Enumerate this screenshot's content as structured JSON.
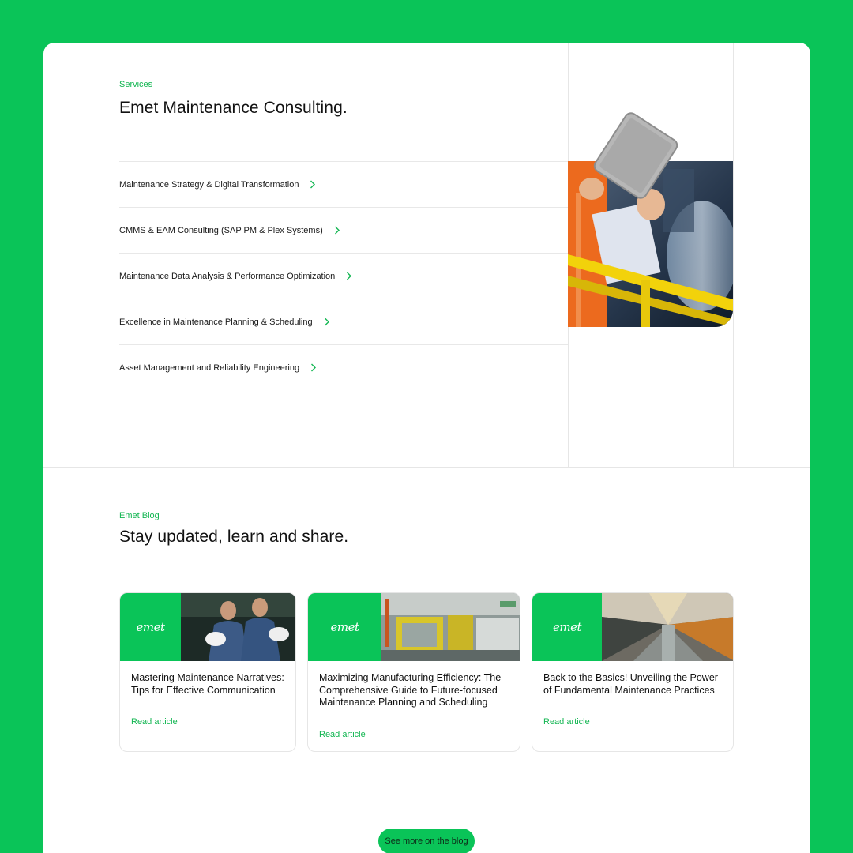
{
  "services": {
    "eyebrow": "Services",
    "title": "Emet Maintenance Consulting.",
    "items": [
      {
        "label": "Maintenance Strategy & Digital Transformation"
      },
      {
        "label": "CMMS & EAM Consulting (SAP PM & Plex Systems)"
      },
      {
        "label": "Maintenance Data Analysis & Performance Optimization"
      },
      {
        "label": "Excellence in Maintenance Planning & Scheduling"
      },
      {
        "label": "Asset Management and Reliability Engineering"
      }
    ]
  },
  "blog": {
    "eyebrow": "Emet Blog",
    "title": "Stay updated, learn and share.",
    "logo_text": "emet",
    "cards": [
      {
        "title": "Mastering Maintenance Narratives: Tips for Effective Communication",
        "link": "Read article"
      },
      {
        "title": "Maximizing Manufacturing Efficiency: The Comprehensive Guide to Future-focused Maintenance Planning and Scheduling",
        "link": "Read article"
      },
      {
        "title": "Back to the Basics! Unveiling the Power of Fundamental Maintenance Practices",
        "link": "Read article"
      }
    ],
    "cta": "See more on the blog"
  },
  "colors": {
    "brand": "#0ac458",
    "accent_text": "#13b652"
  }
}
